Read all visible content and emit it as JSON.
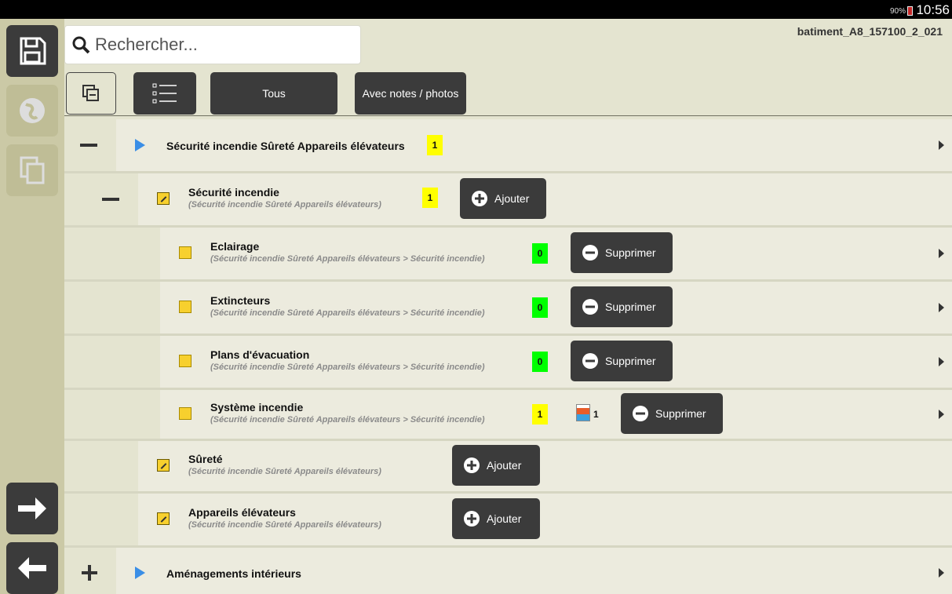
{
  "status": {
    "battery": "90%",
    "time": "10:56"
  },
  "document_name": "batiment_A8_157100_2_021",
  "search": {
    "placeholder": "Rechercher..."
  },
  "filters": {
    "all_label": "Tous",
    "notes_photos_label": "Avec notes / photos"
  },
  "colors": {
    "count_yellow": "#ffff00",
    "count_green": "#00ff00",
    "button_dark": "#3b3b3b",
    "accent_blue": "#3a8ee6"
  },
  "tree": {
    "group1": {
      "title": "Sécurité incendie Sûreté Appareils élévateurs",
      "count": "1"
    },
    "sub1": {
      "title": "Sécurité incendie",
      "path": "(Sécurité incendie Sûreté Appareils élévateurs)",
      "count": "1",
      "action": "Ajouter"
    },
    "items": [
      {
        "title": "Eclairage",
        "path": "(Sécurité incendie Sûreté Appareils élévateurs > Sécurité incendie)",
        "count": "0",
        "action": "Supprimer"
      },
      {
        "title": "Extincteurs",
        "path": "(Sécurité incendie Sûreté Appareils élévateurs > Sécurité incendie)",
        "count": "0",
        "action": "Supprimer"
      },
      {
        "title": "Plans d'évacuation",
        "path": "(Sécurité incendie Sûreté Appareils élévateurs > Sécurité incendie)",
        "count": "0",
        "action": "Supprimer"
      },
      {
        "title": "Système incendie",
        "path": "(Sécurité incendie Sûreté Appareils élévateurs > Sécurité incendie)",
        "count": "1",
        "photo_count": "1",
        "action": "Supprimer"
      }
    ],
    "sub2": {
      "title": "Sûreté",
      "path": "(Sécurité incendie Sûreté Appareils élévateurs)",
      "action": "Ajouter"
    },
    "sub3": {
      "title": "Appareils élévateurs",
      "path": "(Sécurité incendie Sûreté Appareils élévateurs)",
      "action": "Ajouter"
    },
    "group2": {
      "title": "Aménagements intérieurs"
    }
  }
}
